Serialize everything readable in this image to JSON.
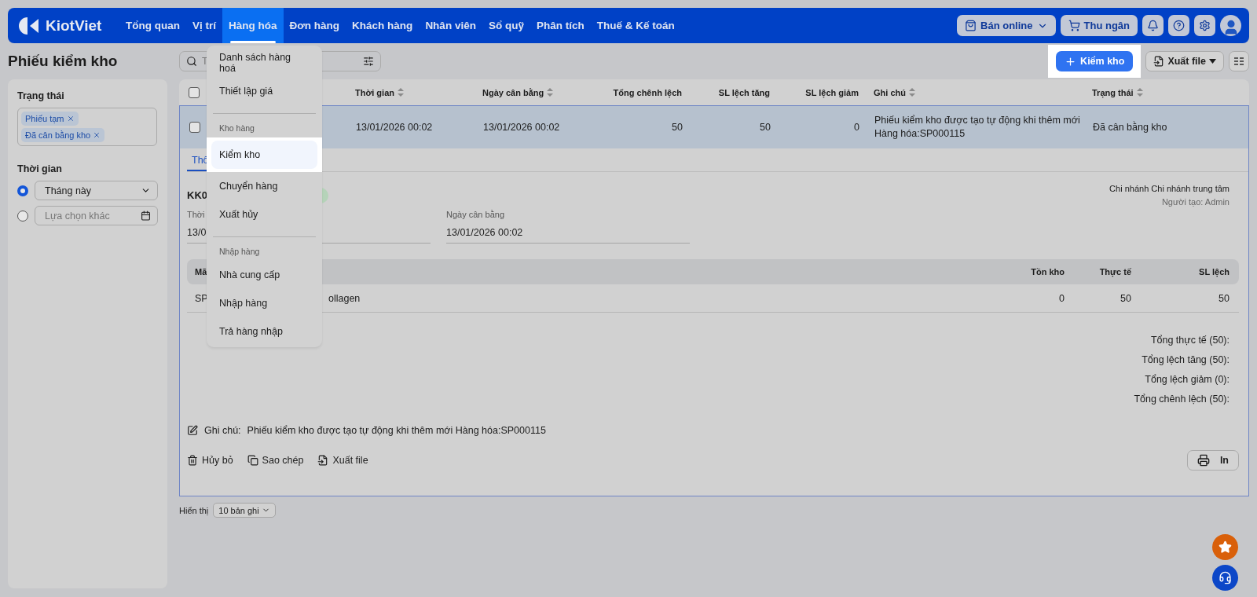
{
  "nav": {
    "logo": "KiotViet",
    "items": [
      {
        "label": "Tổng quan",
        "selected": false
      },
      {
        "label": "Vị trí",
        "selected": false
      },
      {
        "label": "Hàng hóa",
        "selected": true
      },
      {
        "label": "Đơn hàng",
        "selected": false
      },
      {
        "label": "Khách hàng",
        "selected": false
      },
      {
        "label": "Nhân viên",
        "selected": false
      },
      {
        "label": "Sổ quỹ",
        "selected": false
      },
      {
        "label": "Phân tích",
        "selected": false
      },
      {
        "label": "Thuế & Kế toán",
        "selected": false
      }
    ],
    "online_button": "Bán online",
    "cashier_button": "Thu ngân"
  },
  "menu": {
    "sections": [
      {
        "items": [
          {
            "label": "Danh sách hàng hoá",
            "selected": false
          },
          {
            "label": "Thiết lập giá",
            "selected": false
          }
        ]
      },
      {
        "heading": "Kho hàng",
        "items": [
          {
            "label": "Kiểm kho",
            "selected": true
          },
          {
            "label": "Chuyển hàng",
            "selected": false
          },
          {
            "label": "Xuất hủy",
            "selected": false
          }
        ]
      },
      {
        "heading": "Nhập hàng",
        "items": [
          {
            "label": "Nhà cung cấp",
            "selected": false
          },
          {
            "label": "Nhập hàng",
            "selected": false
          },
          {
            "label": "Trả hàng nhập",
            "selected": false
          }
        ]
      }
    ]
  },
  "page_title": "Phiếu kiểm kho",
  "search": {
    "placeholder": "T"
  },
  "actions": {
    "create": "Kiểm kho",
    "export": "Xuất file"
  },
  "filters": {
    "status": {
      "label": "Trạng thái",
      "tags": [
        "Phiếu tạm",
        "Đã cân bằng kho"
      ]
    },
    "time": {
      "label": "Thời gian",
      "options": [
        {
          "kind": "select",
          "value": "Tháng này",
          "selected": true
        },
        {
          "kind": "date",
          "placeholder": "Lựa chọn khác",
          "selected": false
        }
      ]
    }
  },
  "table": {
    "all_checked": false,
    "columns": [
      {
        "label": "Thời gian",
        "sortable": true
      },
      {
        "label": "Ngày cân bằng",
        "sortable": true
      },
      {
        "label": "Tổng chênh lệch",
        "sortable": false
      },
      {
        "label": "SL lệch tăng",
        "sortable": false
      },
      {
        "label": "SL lệch giảm",
        "sortable": false
      },
      {
        "label": "Ghi chú",
        "sortable": true
      },
      {
        "label": "Trạng thái",
        "sortable": true
      }
    ],
    "rows": [
      {
        "selected": true,
        "checked": false,
        "cells": [
          "13/01/2026 00:02",
          "13/01/2026 00:02",
          "50",
          "50",
          "0",
          "Phiếu kiểm kho được tạo tự động khi thêm mới Hàng hóa:SP000115",
          "Đã cân bằng kho"
        ]
      }
    ]
  },
  "detail": {
    "tabs": [
      {
        "label": "Thô",
        "selected": true
      }
    ],
    "code": "KK0",
    "branch": "Chi nhánh Chi nhánh trung tâm",
    "creator": "Người tạo: Admin",
    "fields": [
      {
        "label": "Thời",
        "value": "13/0"
      },
      {
        "label": "Ngày cân bằng",
        "value": "13/01/2026 00:02"
      }
    ],
    "items_table": {
      "columns": [
        "Mã",
        "",
        "Tồn kho",
        "Thực tế",
        "SL lệch"
      ],
      "rows": [
        {
          "cells": [
            "SP",
            "ollagen",
            "0",
            "50",
            "50"
          ]
        }
      ]
    },
    "totals": [
      "Tổng thực tế (50):",
      "Tổng lệch tăng (50):",
      "Tổng lệch giảm (0):",
      "Tổng chênh lệch (50):"
    ],
    "note": {
      "label": "Ghi chú:",
      "text": "Phiếu kiểm kho được tạo tự động khi thêm mới Hàng hóa:SP000115"
    },
    "buttons": [
      {
        "kind": "delete",
        "label": "Hủy bỏ"
      },
      {
        "kind": "copy",
        "label": "Sao chép"
      },
      {
        "kind": "export",
        "label": "Xuất file"
      }
    ],
    "print": "In"
  },
  "pagination": {
    "label": "Hiển thị",
    "value": "10 bản ghi"
  }
}
